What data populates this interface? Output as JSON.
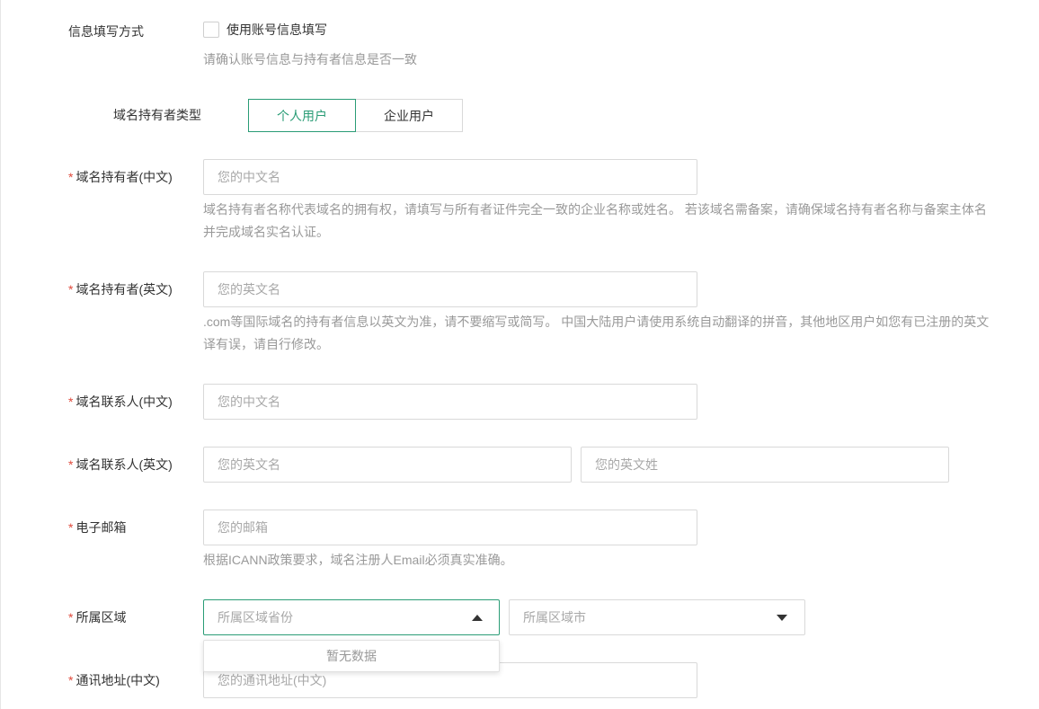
{
  "info_fill": {
    "label": "信息填写方式",
    "checkbox_label": "使用账号信息填写",
    "hint": "请确认账号信息与持有者信息是否一致"
  },
  "holder_type": {
    "label": "域名持有者类型",
    "options": [
      "个人用户",
      "企业用户"
    ],
    "selected": "个人用户"
  },
  "holder_cn": {
    "required_mark": "*",
    "label": "域名持有者(中文)",
    "placeholder": "您的中文名",
    "help_lines": [
      "域名持有者名称代表域名的拥有权，请填写与所有者证件完全一致的企业名称或姓名。 若该域名需备案，请确保域名持有者名称与备案主体名",
      "并完成域名实名认证。"
    ]
  },
  "holder_en": {
    "required_mark": "*",
    "label": "域名持有者(英文)",
    "placeholder": "您的英文名",
    "help_lines": [
      ".com等国际域名的持有者信息以英文为准，请不要缩写或简写。 中国大陆用户请使用系统自动翻译的拼音，其他地区用户如您有已注册的英文",
      "译有误，请自行修改。"
    ]
  },
  "contact_cn": {
    "required_mark": "*",
    "label": "域名联系人(中文)",
    "placeholder": "您的中文名"
  },
  "contact_en": {
    "required_mark": "*",
    "label": "域名联系人(英文)",
    "first_placeholder": "您的英文名",
    "last_placeholder": "您的英文姓"
  },
  "email": {
    "required_mark": "*",
    "label": "电子邮箱",
    "placeholder": "您的邮箱",
    "help": "根据ICANN政策要求，域名注册人Email必须真实准确。"
  },
  "region": {
    "required_mark": "*",
    "label": "所属区域",
    "province_placeholder": "所属区域省份",
    "city_placeholder": "所属区域市",
    "empty_text": "暂无数据"
  },
  "address_cn": {
    "required_mark": "*",
    "label": "通讯地址(中文)",
    "placeholder": "您的通讯地址(中文)"
  },
  "colors": {
    "accent": "#2a9c76",
    "required": "#e04a3c",
    "hint": "#999999"
  }
}
